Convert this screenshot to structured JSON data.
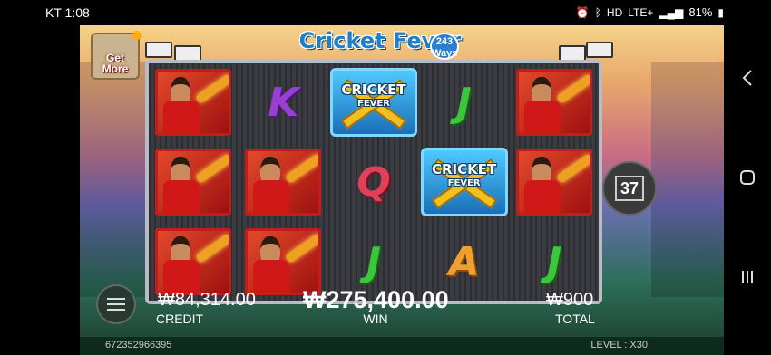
{
  "status_bar": {
    "carrier_time": "KT 1:08",
    "network": "LTE+",
    "battery": "81%"
  },
  "game": {
    "logo": "Cricket Fever",
    "logo_badge_num": "243",
    "logo_badge_word": "Ways",
    "get_more": "Get More",
    "counter": "37",
    "wild_line1": "CRICKET",
    "wild_line2": "FEVER"
  },
  "reels": [
    [
      "player",
      "K",
      "wild",
      "J",
      "player"
    ],
    [
      "player",
      "player",
      "Q",
      "wild",
      "player"
    ],
    [
      "player",
      "player",
      "J",
      "A",
      "J"
    ]
  ],
  "credit": {
    "value": "₩84,314.00",
    "label": "CREDIT"
  },
  "win": {
    "value": "₩275,400.00",
    "label": "WIN"
  },
  "total": {
    "value": "₩900",
    "label": "TOTAL"
  },
  "footer": {
    "round_id": "672352966395",
    "level": "LEVEL : X30"
  },
  "icons": [
    "alarm-icon",
    "bluetooth-icon",
    "hd-icon",
    "signal-icon",
    "battery-icon",
    "back-icon",
    "home-icon",
    "recents-icon",
    "menu-icon"
  ]
}
